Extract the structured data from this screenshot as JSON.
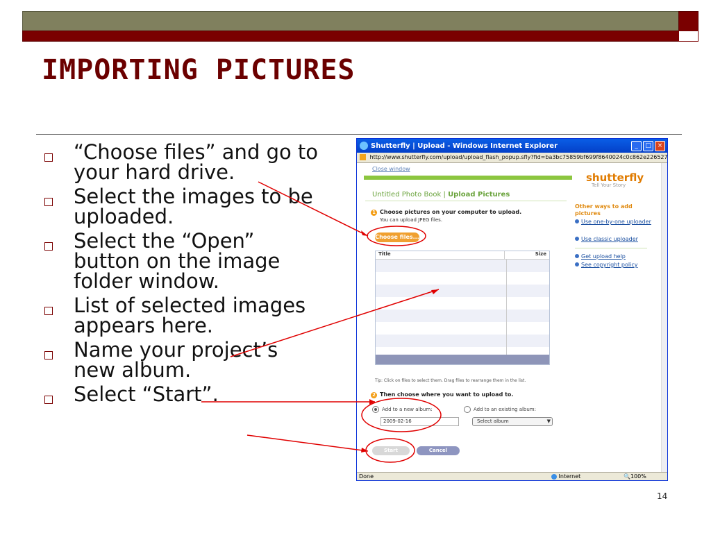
{
  "slide": {
    "title": "IMPORTING PICTURES",
    "bullets": [
      "“Choose files” and go to your hard drive.",
      "Select the images to be uploaded.",
      "Select the “Open” button on the image folder window.",
      "List of selected images appears here.",
      "Name your project’s new album.",
      "Select “Start”."
    ],
    "page_number": "14"
  },
  "browser": {
    "title": "Shutterfly | Upload - Windows Internet Explorer",
    "url": "http://www.shutterfly.com/upload/upload_flash_popup.sfly?fid=ba3bc75859bf699f8640024c0c862e226527157dbac90b",
    "status": "Done",
    "zone": "Internet",
    "zoom": "100%"
  },
  "page": {
    "close_window": "Close window",
    "logo": "shutterfly",
    "tagline": "Tell Your Story",
    "book_name": "Untitled Photo Book",
    "separator": " | ",
    "section": "Upload Pictures",
    "step1_num": "1",
    "step1": "Choose pictures on your computer to upload.",
    "step1_sub": "You can upload JPEG files.",
    "choose_button": "Choose files...",
    "col_title": "Title",
    "col_size": "Size",
    "tip": "Tip: Click on files to select them.  Drag files to rearrange them in the list.",
    "step2_num": "2",
    "step2": "Then choose where you want to upload to.",
    "opt_new": "Add to a new album:",
    "opt_existing": "Add to an existing album:",
    "new_album_value": "2009-02-16",
    "select_album": "Select album",
    "start_button": "Start",
    "cancel_button": "Cancel",
    "side_heading": "Other ways to add pictures",
    "side_links": [
      "Use one-by-one uploader",
      "Use classic uploader",
      "Get upload help",
      "See copyright policy"
    ]
  },
  "colors": {
    "accent_red": "#7a0000",
    "olive": "#80805e",
    "annotation": "#e00000"
  }
}
